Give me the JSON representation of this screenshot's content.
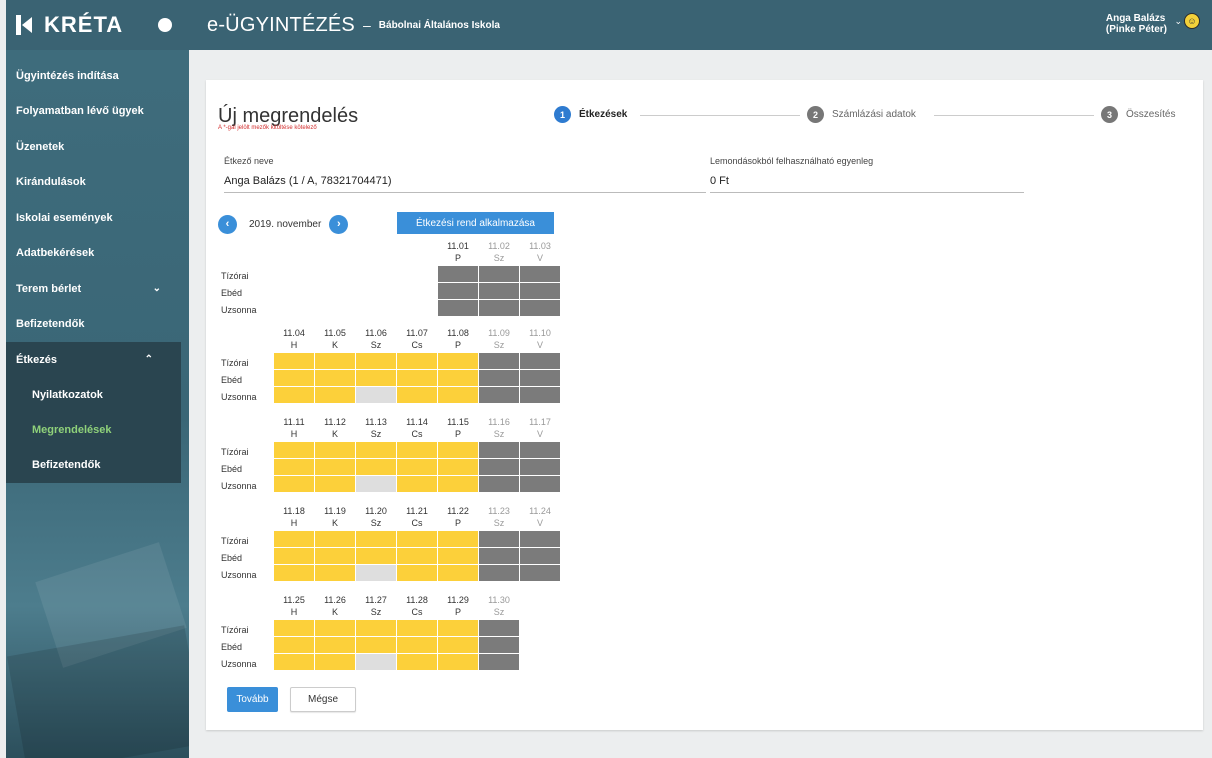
{
  "brand": {
    "name": "KRÉTA"
  },
  "header": {
    "app_title": "e-ÜGYINTÉZÉS",
    "separator": "–",
    "school": "Bábolnai Általános Iskola",
    "user_line1": "Anga Balázs",
    "user_line2": "(Pinke Péter)"
  },
  "sidebar": {
    "items": [
      {
        "label": "Ügyintézés indítása"
      },
      {
        "label": "Folyamatban lévő ügyek"
      },
      {
        "label": "Üzenetek"
      },
      {
        "label": "Kirándulások"
      },
      {
        "label": "Iskolai események"
      },
      {
        "label": "Adatbekérések"
      },
      {
        "label": "Terem bérlet"
      },
      {
        "label": "Befizetendők"
      }
    ],
    "group": {
      "label": "Étkezés",
      "subitems": [
        {
          "label": "Nyilatkozatok"
        },
        {
          "label": "Megrendelések"
        },
        {
          "label": "Befizetendők"
        }
      ]
    }
  },
  "page": {
    "title": "Új megrendelés",
    "required_note": "A *-gal jelölt mezők kitöltése kötelező"
  },
  "stepper": {
    "steps": [
      {
        "num": "1",
        "label": "Étkezések"
      },
      {
        "num": "2",
        "label": "Számlázási adatok"
      },
      {
        "num": "3",
        "label": "Összesítés"
      }
    ]
  },
  "form": {
    "diner_label": "Étkező neve",
    "diner_value": "Anga Balázs (1 / A, 78321704471)",
    "balance_label": "Lemondásokból felhasználható egyenleg",
    "balance_value": "0 Ft"
  },
  "calendar": {
    "month": "2019. november",
    "apply_label": "Étkezési rend alkalmazása",
    "meal_labels": [
      "Tízórai",
      "Ebéd",
      "Uzsonna"
    ],
    "weeks": [
      {
        "days": [
          {
            "date": "11.01",
            "dow": "P",
            "weekend": false
          },
          {
            "date": "11.02",
            "dow": "Sz",
            "weekend": true
          },
          {
            "date": "11.03",
            "dow": "V",
            "weekend": true
          }
        ]
      },
      {
        "days": [
          {
            "date": "11.04",
            "dow": "H",
            "weekend": false
          },
          {
            "date": "11.05",
            "dow": "K",
            "weekend": false
          },
          {
            "date": "11.06",
            "dow": "Sz",
            "weekend": false
          },
          {
            "date": "11.07",
            "dow": "Cs",
            "weekend": false
          },
          {
            "date": "11.08",
            "dow": "P",
            "weekend": false
          },
          {
            "date": "11.09",
            "dow": "Sz",
            "weekend": true
          },
          {
            "date": "11.10",
            "dow": "V",
            "weekend": true
          }
        ]
      },
      {
        "days": [
          {
            "date": "11.11",
            "dow": "H",
            "weekend": false
          },
          {
            "date": "11.12",
            "dow": "K",
            "weekend": false
          },
          {
            "date": "11.13",
            "dow": "Sz",
            "weekend": false
          },
          {
            "date": "11.14",
            "dow": "Cs",
            "weekend": false
          },
          {
            "date": "11.15",
            "dow": "P",
            "weekend": false
          },
          {
            "date": "11.16",
            "dow": "Sz",
            "weekend": true
          },
          {
            "date": "11.17",
            "dow": "V",
            "weekend": true
          }
        ]
      },
      {
        "days": [
          {
            "date": "11.18",
            "dow": "H",
            "weekend": false
          },
          {
            "date": "11.19",
            "dow": "K",
            "weekend": false
          },
          {
            "date": "11.20",
            "dow": "Sz",
            "weekend": false
          },
          {
            "date": "11.21",
            "dow": "Cs",
            "weekend": false
          },
          {
            "date": "11.22",
            "dow": "P",
            "weekend": false
          },
          {
            "date": "11.23",
            "dow": "Sz",
            "weekend": true
          },
          {
            "date": "11.24",
            "dow": "V",
            "weekend": true
          }
        ]
      },
      {
        "days": [
          {
            "date": "11.25",
            "dow": "H",
            "weekend": false
          },
          {
            "date": "11.26",
            "dow": "K",
            "weekend": false
          },
          {
            "date": "11.27",
            "dow": "Sz",
            "weekend": false
          },
          {
            "date": "11.28",
            "dow": "Cs",
            "weekend": false
          },
          {
            "date": "11.29",
            "dow": "P",
            "weekend": false
          },
          {
            "date": "11.30",
            "dow": "Sz",
            "weekend": true
          }
        ]
      }
    ]
  },
  "actions": {
    "next_label": "Tovább",
    "cancel_label": "Mégse"
  },
  "colors": {
    "ordered": "#fcd03a",
    "unavailable": "#7b7b7b",
    "not_ordered": "#dedede",
    "primary": "#3a8fd9",
    "active_menu": "#8fd17a"
  }
}
